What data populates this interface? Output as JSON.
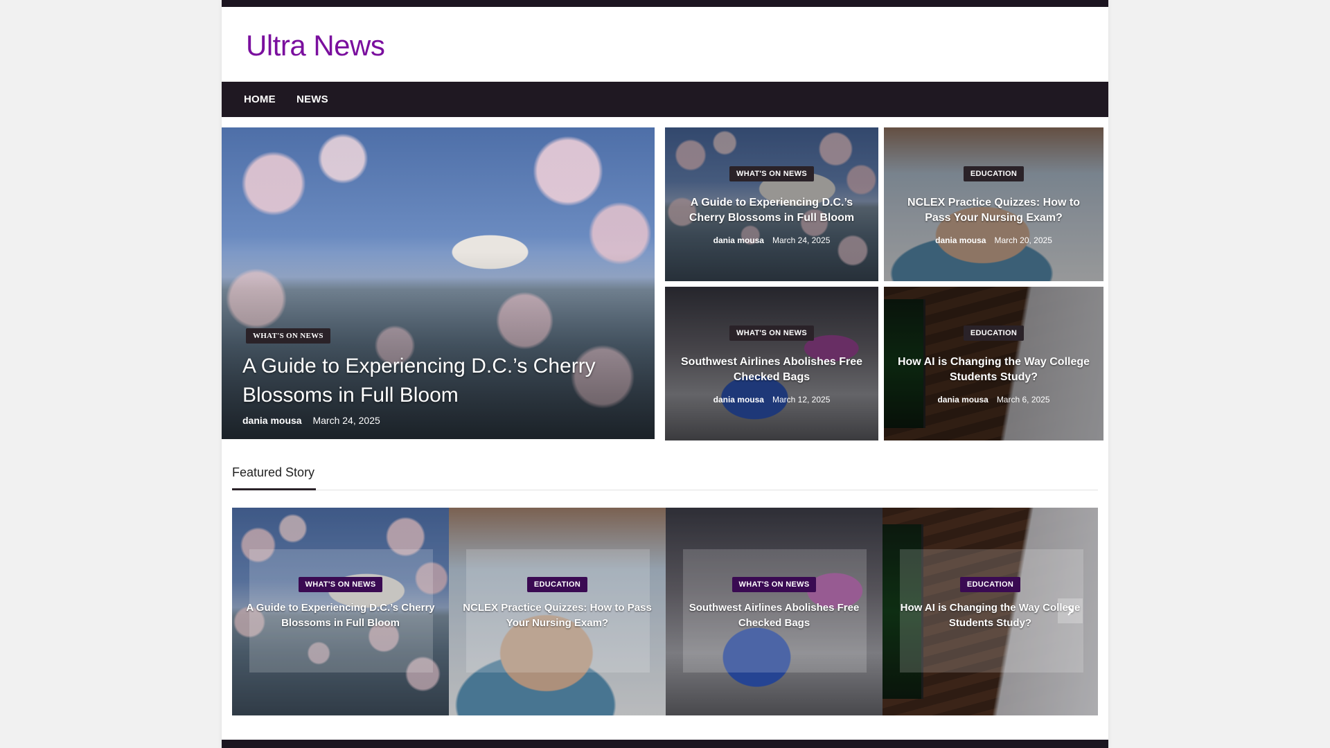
{
  "site": {
    "title": "Ultra News"
  },
  "nav": {
    "items": [
      {
        "label": "HOME"
      },
      {
        "label": "NEWS"
      }
    ]
  },
  "hero": {
    "category": "WHAT'S ON NEWS",
    "title": "A Guide to Experiencing D.C.’s Cherry Blossoms in Full Bloom",
    "author": "dania mousa",
    "date": "March 24, 2025"
  },
  "grid": [
    {
      "category": "WHAT'S ON NEWS",
      "title": "A Guide to Experiencing D.C.’s Cherry Blossoms in Full Bloom",
      "author": "dania mousa",
      "date": "March 24, 2025"
    },
    {
      "category": "EDUCATION",
      "title": "NCLEX Practice Quizzes: How to Pass Your Nursing Exam?",
      "author": "dania mousa",
      "date": "March 20, 2025"
    },
    {
      "category": "WHAT'S ON NEWS",
      "title": "Southwest Airlines Abolishes Free Checked Bags",
      "author": "dania mousa",
      "date": "March 12, 2025"
    },
    {
      "category": "EDUCATION",
      "title": "How AI is Changing the Way College Students Study?",
      "author": "dania mousa",
      "date": "March 6, 2025"
    }
  ],
  "featured": {
    "heading": "Featured Story",
    "items": [
      {
        "category": "WHAT'S ON NEWS",
        "title": "A Guide to Experiencing D.C.’s Cherry Blossoms in Full Bloom"
      },
      {
        "category": "EDUCATION",
        "title": "NCLEX Practice Quizzes: How to Pass Your Nursing Exam?"
      },
      {
        "category": "WHAT'S ON NEWS",
        "title": "Southwest Airlines Abolishes Free Checked Bags"
      },
      {
        "category": "EDUCATION",
        "title": "How AI is Changing the Way College Students Study?"
      }
    ],
    "next_icon": "chevron-right-icon"
  },
  "colors": {
    "brand": "#7a0f9e",
    "nav_bg": "#1f1822",
    "tag_purple": "#3a0a52"
  }
}
